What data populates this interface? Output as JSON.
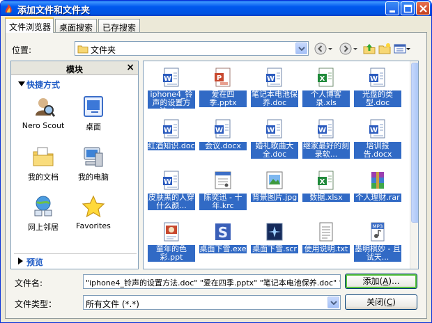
{
  "window": {
    "title": "添加文件和文件夹"
  },
  "tabs": [
    {
      "label": "文件浏览器",
      "active": true
    },
    {
      "label": "桌面搜索",
      "active": false
    },
    {
      "label": "已存搜索",
      "active": false
    }
  ],
  "location": {
    "label": "位置:",
    "value": "文件夹"
  },
  "side": {
    "header": "模块",
    "close": "×",
    "section": "快捷方式",
    "shortcuts": [
      {
        "label": "Nero Scout",
        "icon": "nero-scout-icon"
      },
      {
        "label": "桌面",
        "icon": "desktop-icon"
      },
      {
        "label": "我的文档",
        "icon": "my-documents-icon"
      },
      {
        "label": "我的电脑",
        "icon": "my-computer-icon"
      },
      {
        "label": "网上邻居",
        "icon": "network-places-icon"
      },
      {
        "label": "Favorites",
        "icon": "favorites-star-icon"
      }
    ],
    "preview": "预览"
  },
  "files": [
    {
      "name": "iphone4_铃声的设置方法.doc",
      "type": "word"
    },
    {
      "name": "爱在四季.pptx",
      "type": "ppt"
    },
    {
      "name": "笔记本电池保养.doc",
      "type": "word"
    },
    {
      "name": "个人博客录.xls",
      "type": "excel"
    },
    {
      "name": "光盘的类型.doc",
      "type": "word"
    },
    {
      "name": "红酒知识.doc",
      "type": "word"
    },
    {
      "name": "会议.docx",
      "type": "word"
    },
    {
      "name": "婚礼歌曲大全.doc",
      "type": "word"
    },
    {
      "name": "继家最好的刻录软...",
      "type": "word"
    },
    {
      "name": "培训报告.docx",
      "type": "word"
    },
    {
      "name": "皮肤黑的人穿什么颜...",
      "type": "word"
    },
    {
      "name": "陈奕迅 - 十年.krc",
      "type": "lyric"
    },
    {
      "name": "背景图片.jpg",
      "type": "image"
    },
    {
      "name": "数据.xlsx",
      "type": "excel"
    },
    {
      "name": "个人理财.rar",
      "type": "rar"
    },
    {
      "name": "童年的色彩.ppt",
      "type": "ppt2"
    },
    {
      "name": "桌面下雪.exe",
      "type": "exe"
    },
    {
      "name": "桌面下雪.scr",
      "type": "scr"
    },
    {
      "name": "使用说明.txt",
      "type": "txt"
    },
    {
      "name": "墨明棋妙 - 且试天...",
      "type": "mp3"
    }
  ],
  "filename": {
    "label": "文件名:",
    "value": "\"iphone4_铃声的设置方法.doc\" \"爱在四季.pptx\" \"笔记本电池保养.doc\" \"个"
  },
  "filetype": {
    "label": "文件类型：",
    "value": "所有文件 (*.*)"
  },
  "buttons": {
    "add": {
      "text": "添加",
      "key": "A",
      "suffix": "..."
    },
    "close": {
      "text": "关闭",
      "key": "C"
    }
  },
  "colors": {
    "titlebar": "#0058EE",
    "selection": "#316AC5",
    "section_text": "#215DC6",
    "face": "#ECE9D8"
  }
}
